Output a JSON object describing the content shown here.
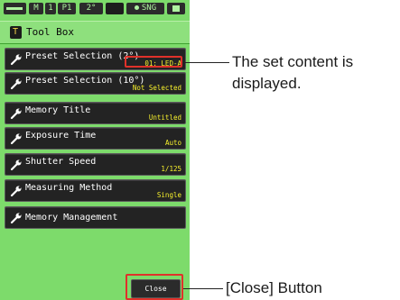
{
  "status_bar": {
    "m": "M",
    "num": "1",
    "p": "P1",
    "angle": "2°",
    "mode": "SNG"
  },
  "title": "Tool Box",
  "menu": [
    {
      "label": "Preset Selection (2°)",
      "value": "01: LED-A"
    },
    {
      "label": "Preset Selection (10°)",
      "value": "Not Selected"
    },
    {
      "label": "Memory Title",
      "value": "Untitled"
    },
    {
      "label": "Exposure Time",
      "value": "Auto"
    },
    {
      "label": "Shutter Speed",
      "value": "1/125"
    },
    {
      "label": "Measuring Method",
      "value": "Single"
    },
    {
      "label": "Memory Management",
      "value": ""
    }
  ],
  "close_label": "Close",
  "callouts": {
    "content": "The set content is displayed.",
    "close": "[Close] Button"
  },
  "colors": {
    "screen_bg": "#7ddb6b",
    "item_bg": "#232323",
    "value_text": "#f7f12c",
    "highlight": "#e0312a"
  }
}
